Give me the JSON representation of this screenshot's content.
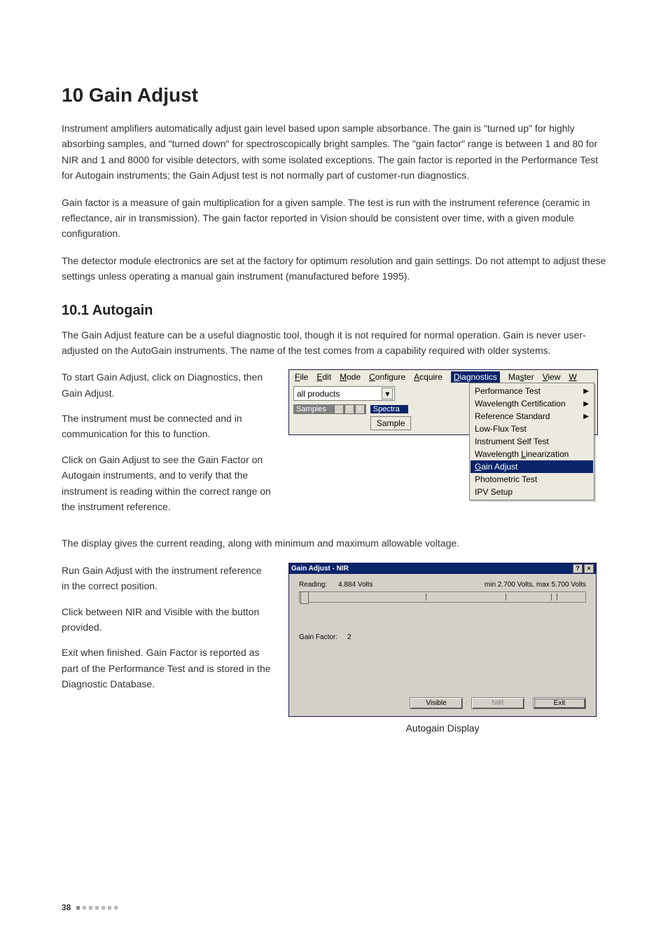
{
  "page_number": "38",
  "section": {
    "number": "10",
    "title": "Gain Adjust",
    "full_title": "10 Gain Adjust",
    "paragraphs": [
      "Instrument amplifiers automatically adjust gain level based upon sample absorbance. The gain is \"turned up\" for highly absorbing samples, and \"turned down\" for spectroscopically bright samples. The \"gain factor\" range is between 1 and 80 for NIR and 1 and 8000 for visible detectors, with some isolated exceptions. The gain factor is reported in the Performance Test for Autogain instruments; the Gain Adjust test is not normally part of customer-run diagnostics.",
      "Gain factor is a measure of gain multiplication for a given sample. The test is run with the instrument reference (ceramic in reflectance, air in transmission). The gain factor reported in Vision should be consistent over time, with a given module configuration.",
      "The detector module electronics are set at the factory for optimum resolution and gain settings. Do not attempt to adjust these settings unless operating a manual gain instrument (manufactured before 1995)."
    ]
  },
  "subsection": {
    "number": "10.1",
    "title": "Autogain",
    "full_title": "10.1 Autogain",
    "intro": "The Gain Adjust feature can be a useful diagnostic tool, though it is not required for normal operation. Gain is never user-adjusted on the AutoGain instruments. The name of the test comes from a capability required with older systems.",
    "left_block1": [
      "To start Gain Adjust, click on Diagnostics, then Gain Adjust.",
      "The instrument must be connected and in communication for this to function.",
      "Click on Gain Adjust to see the Gain Factor on Autogain instruments, and to verify that the instrument is reading within the correct range on the instrument reference."
    ],
    "mid_para": "The display gives the current reading, along with minimum and maximum allowable voltage.",
    "left_block2": [
      "Run Gain Adjust with the instrument reference in the correct position.",
      "Click between NIR and Visible with the button provided.",
      "Exit when finished. Gain Factor is reported as part of the Performance Test and is stored in the Diagnostic Database."
    ]
  },
  "menu_figure": {
    "menubar": [
      "File",
      "Edit",
      "Mode",
      "Configure",
      "Acquire",
      "Diagnostics",
      "Master",
      "View",
      "W"
    ],
    "selected_menu": "Diagnostics",
    "combo_value": "all products",
    "mdi_samples": "Samples",
    "mdi_spectra": "Spectra",
    "sample_button": "Sample",
    "dropdown_items": [
      {
        "label": "Performance Test",
        "submenu": true,
        "mnemonic_index": -1
      },
      {
        "label": "Wavelength Certification",
        "submenu": true,
        "mnemonic_index": -1
      },
      {
        "label": "Reference Standard",
        "submenu": true,
        "mnemonic_index": -1
      },
      {
        "label": "Low-Flux Test",
        "submenu": false,
        "mnemonic_index": -1
      },
      {
        "label": "Instrument Self Test",
        "submenu": false,
        "mnemonic_index": -1
      },
      {
        "label": "Wavelength Linearization",
        "submenu": false,
        "mnemonic_index": 11
      },
      {
        "label": "Gain Adjust",
        "submenu": false,
        "selected": true,
        "mnemonic_index": 0
      },
      {
        "label": "Photometric Test",
        "submenu": false,
        "mnemonic_index": -1
      },
      {
        "label": "IPV Setup",
        "submenu": false,
        "mnemonic_index": -1
      }
    ]
  },
  "dialog_figure": {
    "title": "Gain Adjust - NIR",
    "reading_label": "Reading:",
    "reading_value": "4.884 Volts",
    "range_label": "min 2.700 Volts,  max 5.700 Volts",
    "gain_factor_label": "Gain Factor:",
    "gain_factor_value": "2",
    "buttons": {
      "visible": "Visible",
      "nir": "NIR",
      "exit": "Exit"
    },
    "caption": "Autogain Display"
  }
}
